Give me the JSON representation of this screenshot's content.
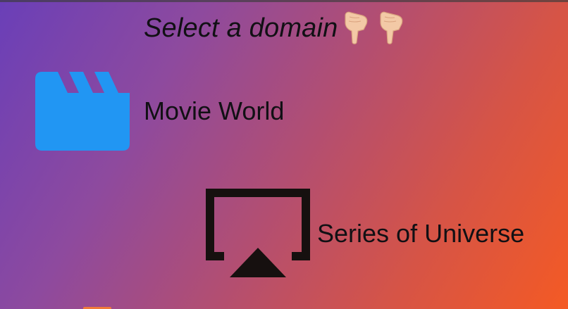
{
  "header": {
    "title": "Select a domain",
    "pointer_icons": [
      "pointing-down-hand-icon",
      "pointing-down-hand-icon"
    ]
  },
  "domains": [
    {
      "label": "Movie World",
      "icon": "clapperboard-icon",
      "icon_color": "#2196f3"
    },
    {
      "label": "Series of Universe",
      "icon": "airplay-icon",
      "icon_color": "#16100f"
    }
  ],
  "theme": {
    "gradient_start": "#6a3fb8",
    "gradient_end": "#f45a24",
    "text_color": "#111014"
  }
}
